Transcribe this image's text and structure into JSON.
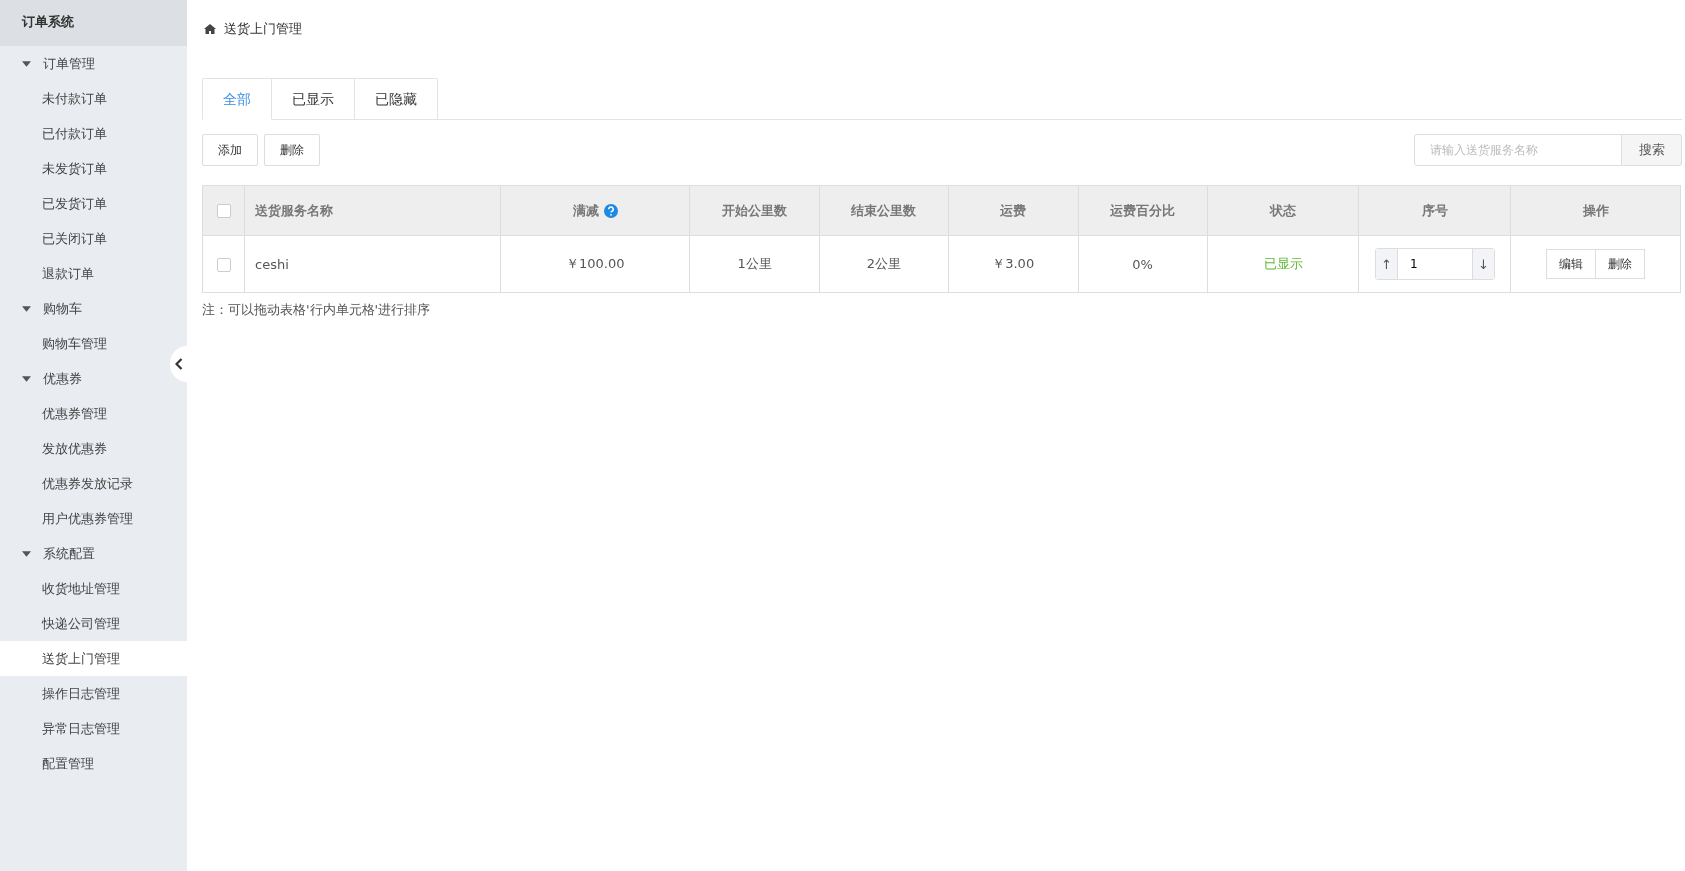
{
  "sidebar": {
    "title": "订单系统",
    "groups": [
      {
        "label": "订单管理",
        "expanded": true,
        "children": [
          {
            "label": "未付款订单",
            "selected": false
          },
          {
            "label": "已付款订单",
            "selected": false
          },
          {
            "label": "未发货订单",
            "selected": false
          },
          {
            "label": "已发货订单",
            "selected": false
          },
          {
            "label": "已关闭订单",
            "selected": false
          },
          {
            "label": "退款订单",
            "selected": false
          }
        ]
      },
      {
        "label": "购物车",
        "expanded": true,
        "children": [
          {
            "label": "购物车管理",
            "selected": false
          }
        ]
      },
      {
        "label": "优惠券",
        "expanded": true,
        "children": [
          {
            "label": "优惠券管理",
            "selected": false
          },
          {
            "label": "发放优惠券",
            "selected": false
          },
          {
            "label": "优惠券发放记录",
            "selected": false
          },
          {
            "label": "用户优惠券管理",
            "selected": false
          }
        ]
      },
      {
        "label": "系统配置",
        "expanded": true,
        "children": [
          {
            "label": "收货地址管理",
            "selected": false
          },
          {
            "label": "快递公司管理",
            "selected": false
          },
          {
            "label": "送货上门管理",
            "selected": true
          },
          {
            "label": "操作日志管理",
            "selected": false
          },
          {
            "label": "异常日志管理",
            "selected": false
          },
          {
            "label": "配置管理",
            "selected": false
          }
        ]
      }
    ]
  },
  "breadcrumb": "送货上门管理",
  "tabs": [
    {
      "label": "全部",
      "selected": true
    },
    {
      "label": "已显示",
      "selected": false
    },
    {
      "label": "已隐藏",
      "selected": false
    }
  ],
  "toolbar": {
    "buttons": [
      "添加",
      "删除"
    ],
    "search": {
      "placeholder": "请输入送货服务名称",
      "button": "搜索"
    }
  },
  "table": {
    "header_checked": false,
    "columns": [
      "送货服务名称",
      "满减",
      "开始公里数",
      "结束公里数",
      "运费",
      "运费百分比",
      "状态",
      "序号",
      "操作"
    ],
    "rows": [
      {
        "checked": false,
        "name": "ceshi",
        "discount": "￥100.00",
        "start_km": "1公里",
        "end_km": "2公里",
        "fee": "￥3.00",
        "fee_percent": "0%",
        "status": "已显示",
        "order": "1",
        "order_up": "↑",
        "order_down": "↓",
        "actions": [
          "编辑",
          "删除"
        ]
      }
    ]
  },
  "note": "注：可以拖动表格'行内单元格'进行排序"
}
